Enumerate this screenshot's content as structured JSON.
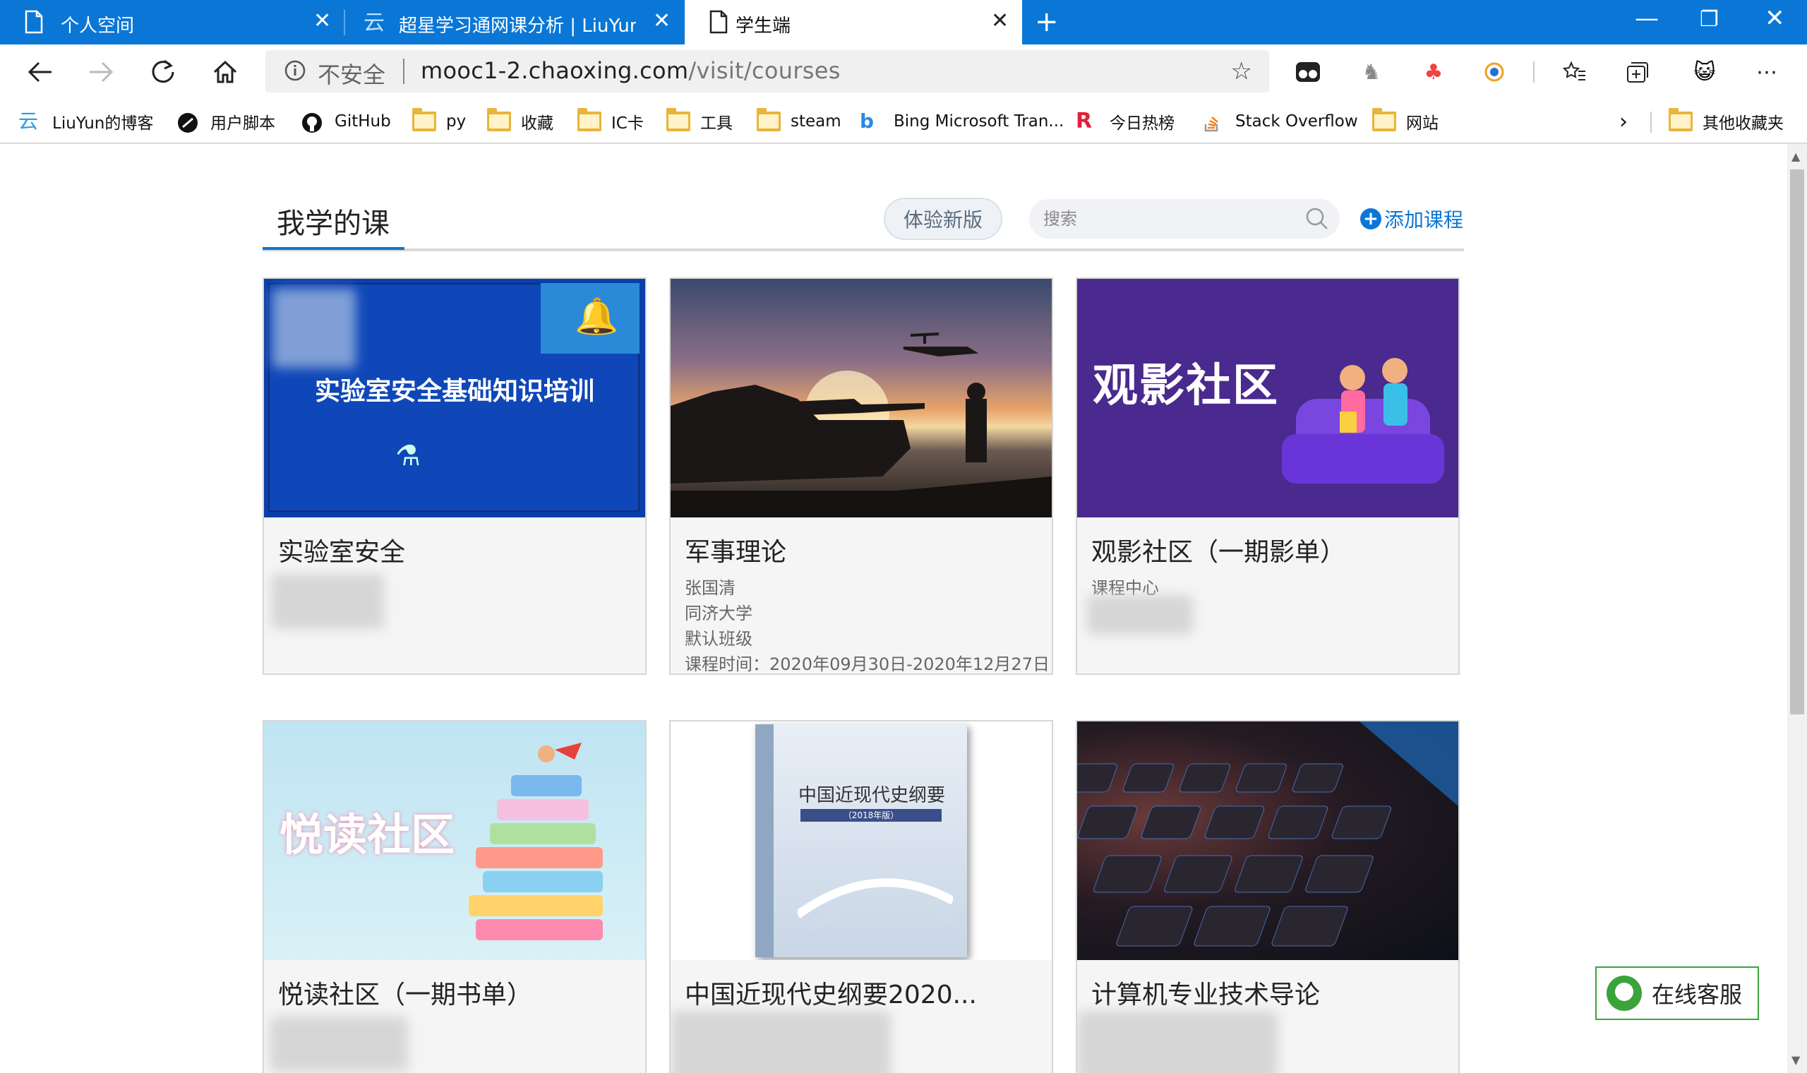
{
  "browser": {
    "tabs": [
      {
        "label": "个人空间",
        "active": false,
        "icon": "page-icon"
      },
      {
        "label": "超星学习通网课分析 | LiuYun的博",
        "active": false,
        "icon": "cloud-logo-icon"
      },
      {
        "label": "学生端",
        "active": true,
        "icon": "page-icon"
      }
    ],
    "address": {
      "security_label": "不安全",
      "host": "mooc1-2.chaoxing.com",
      "path": "/visit/courses"
    },
    "bookmarks": [
      {
        "label": "LiuYun的博客",
        "icon": "cloud-logo-icon"
      },
      {
        "label": "用户脚本",
        "icon": "userscript-icon"
      },
      {
        "label": "GitHub",
        "icon": "github-icon"
      },
      {
        "label": "py",
        "icon": "folder-icon"
      },
      {
        "label": "收藏",
        "icon": "folder-icon"
      },
      {
        "label": "IC卡",
        "icon": "folder-icon"
      },
      {
        "label": "工具",
        "icon": "folder-icon"
      },
      {
        "label": "steam",
        "icon": "folder-icon"
      },
      {
        "label": "Bing Microsoft Tran...",
        "icon": "bing-icon"
      },
      {
        "label": "今日热榜",
        "icon": "r-logo-icon"
      },
      {
        "label": "Stack Overflow",
        "icon": "stackoverflow-icon"
      },
      {
        "label": "网站",
        "icon": "folder-icon"
      }
    ],
    "other_bookmarks": "其他收藏夹"
  },
  "page": {
    "title": "我学的课",
    "try_new_label": "体验新版",
    "search_placeholder": "搜索",
    "add_course_label": "添加课程",
    "courses": [
      {
        "title": "实验室安全",
        "thumb_text": "实验室安全基础知识培训",
        "meta": []
      },
      {
        "title": "军事理论",
        "meta": [
          "张国清",
          "同济大学",
          "默认班级",
          "课程时间：2020年09月30日-2020年12月27日"
        ]
      },
      {
        "title": "观影社区（一期影单）",
        "thumb_text": "观影社区",
        "meta": [
          "课程中心"
        ]
      },
      {
        "title": "悦读社区（一期书单）",
        "thumb_text": "悦读社区",
        "meta": []
      },
      {
        "title": "中国近现代史纲要2020...",
        "thumb_text": "中国近现代史纲要",
        "thumb_subtext": "（2018年版）",
        "meta": []
      },
      {
        "title": "计算机专业技术导论",
        "meta": []
      }
    ],
    "service_label": "在线客服"
  },
  "colors": {
    "tabbar": "#0a77d6",
    "accent": "#0a77d6",
    "service": "#3aa43a"
  }
}
